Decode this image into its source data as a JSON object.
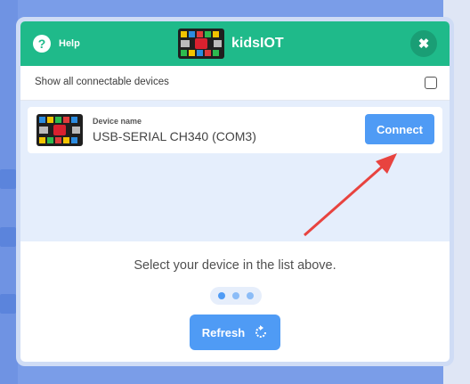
{
  "header": {
    "help_label": "Help",
    "help_icon_glyph": "?",
    "title": "kidsIOT",
    "close_glyph": "✖"
  },
  "filter": {
    "show_all_label": "Show all connectable devices",
    "show_all_checked": false
  },
  "devices": [
    {
      "name_label": "Device name",
      "name": "USB-SERIAL CH340 (COM3)",
      "connect_label": "Connect"
    }
  ],
  "instruction": "Select your device in the list above.",
  "pager": {
    "dots": 3,
    "active_index": 0
  },
  "refresh_label": "Refresh",
  "colors": {
    "header": "#1fba8a",
    "button": "#4f9bf5",
    "list_bg": "#e5eefc",
    "arrow": "#e8433f"
  }
}
